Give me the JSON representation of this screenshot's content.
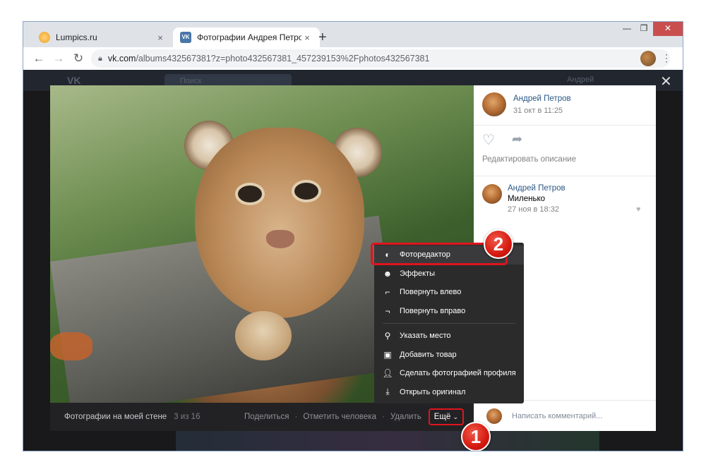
{
  "browser": {
    "tabs": [
      {
        "title": "Lumpics.ru",
        "close": "×"
      },
      {
        "title": "Фотографии Андрея Петрова –",
        "close": "×"
      }
    ],
    "new_tab": "+",
    "window_controls": {
      "minimize": "—",
      "maximize": "❐",
      "close": "✕"
    },
    "url_host": "vk.com",
    "url_path": "/albums432567381?z=photo432567381_457239153%2Fphotos432567381"
  },
  "vk": {
    "logo": "VK",
    "search_placeholder": "Поиск",
    "user_name": "Андрей"
  },
  "post": {
    "author": "Андрей Петров",
    "date": "31 окт в 11:25",
    "edit_description": "Редактировать описание"
  },
  "comment": {
    "author": "Андрей Петров",
    "text": "Миленько",
    "date": "27 ноя в 18:32"
  },
  "comment_input": {
    "placeholder": "Написать комментарий..."
  },
  "photo_bar": {
    "album": "Фотографии на моей стене",
    "counter": "3 из 16",
    "share": "Поделиться",
    "tag": "Отметить человека",
    "delete": "Удалить",
    "more": "Ещё",
    "separator": "·"
  },
  "menu": {
    "items": [
      {
        "label": "Фоторедактор",
        "icon": "contrast-icon"
      },
      {
        "label": "Эффекты",
        "icon": "smiley-icon"
      },
      {
        "label": "Повернуть влево",
        "icon": "rotate-left-icon"
      },
      {
        "label": "Повернуть вправо",
        "icon": "rotate-right-icon"
      },
      {
        "label": "Указать место",
        "icon": "location-pin-icon"
      },
      {
        "label": "Добавить товар",
        "icon": "shopping-bag-icon"
      },
      {
        "label": "Сделать фотографией профиля",
        "icon": "person-icon"
      },
      {
        "label": "Открыть оригинал",
        "icon": "download-icon"
      }
    ]
  },
  "annotations": {
    "step1": "1",
    "step2": "2"
  },
  "colors": {
    "vk_link": "#2a5885",
    "highlight_red": "#e0141e",
    "menu_bg": "#2b2b2c",
    "viewer_bg": "#19191b"
  }
}
